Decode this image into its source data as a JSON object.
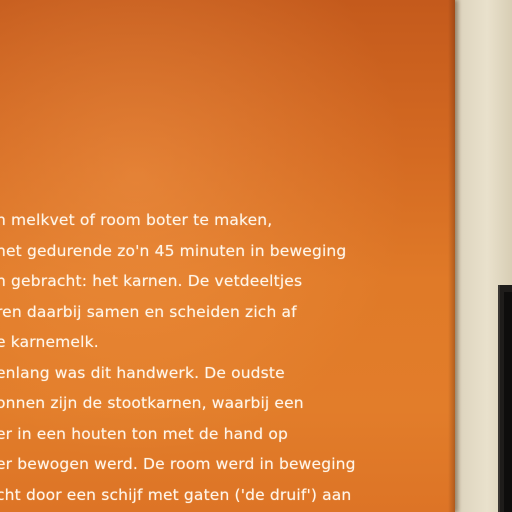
{
  "panel": {
    "lines": [
      "n melkvet of room boter te maken,",
      "het gedurende zo'n 45 minuten in beweging",
      "n gebracht: het karnen. De vetdeeltjes",
      "ren daarbij samen en scheiden zich af",
      "e karnemelk.",
      "enlang was dit handwerk. De oudste",
      "onnen zijn de stootkarnen, waarbij een",
      "er in een houten ton met de hand op",
      "er bewogen werd. De room werd in beweging",
      "cht door een schijf met gaten ('de druif') aan"
    ]
  },
  "colors": {
    "panel": "#e07a28",
    "text": "#fff6ea",
    "wall": "#e9e1cc",
    "frame": "#1e1c1a"
  }
}
